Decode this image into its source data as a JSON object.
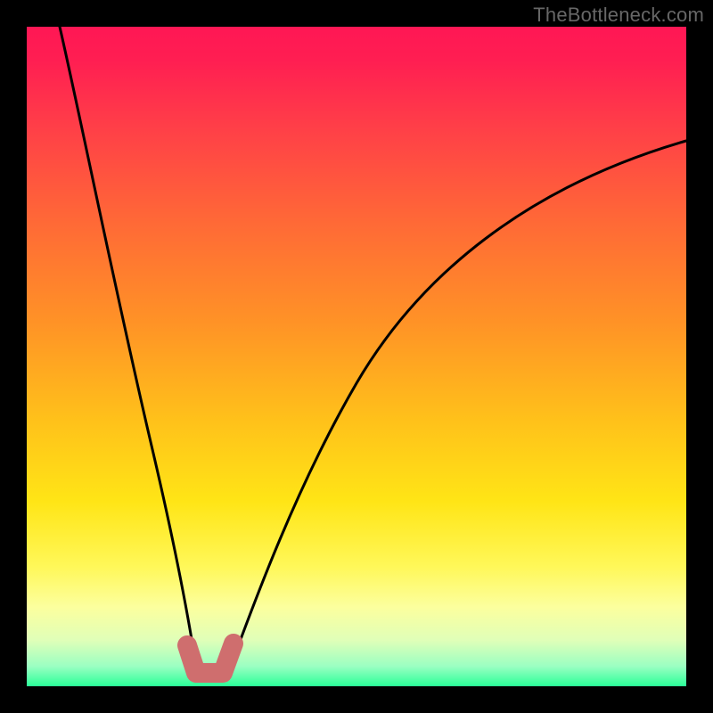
{
  "watermark": "TheBottleneck.com",
  "chart_data": {
    "type": "line",
    "title": "",
    "xlabel": "",
    "ylabel": "",
    "xlim": [
      0,
      100
    ],
    "ylim": [
      0,
      100
    ],
    "series": [
      {
        "name": "curve-left",
        "x": [
          5,
          7,
          9,
          11,
          13,
          15,
          17,
          19,
          21,
          23,
          24.5,
          25.5
        ],
        "values": [
          100,
          84,
          70,
          57,
          46,
          36,
          27,
          19,
          12,
          6,
          3,
          1
        ]
      },
      {
        "name": "curve-right",
        "x": [
          30,
          32,
          35,
          40,
          45,
          50,
          55,
          60,
          65,
          70,
          75,
          80,
          85,
          90,
          95,
          100
        ],
        "values": [
          1,
          4,
          9,
          18,
          27,
          35,
          42,
          49,
          55,
          60,
          65,
          69,
          73,
          76,
          79,
          82
        ]
      },
      {
        "name": "v-marker",
        "x": [
          24.5,
          25.5,
          27,
          28.5,
          30,
          31
        ],
        "values": [
          4.5,
          1.5,
          1.0,
          1.0,
          1.5,
          5.0
        ]
      }
    ],
    "colors": {
      "curve": "#000000",
      "marker": "#cf6e6e",
      "background_top": "#ff1754",
      "background_bottom": "#2bff98"
    }
  }
}
